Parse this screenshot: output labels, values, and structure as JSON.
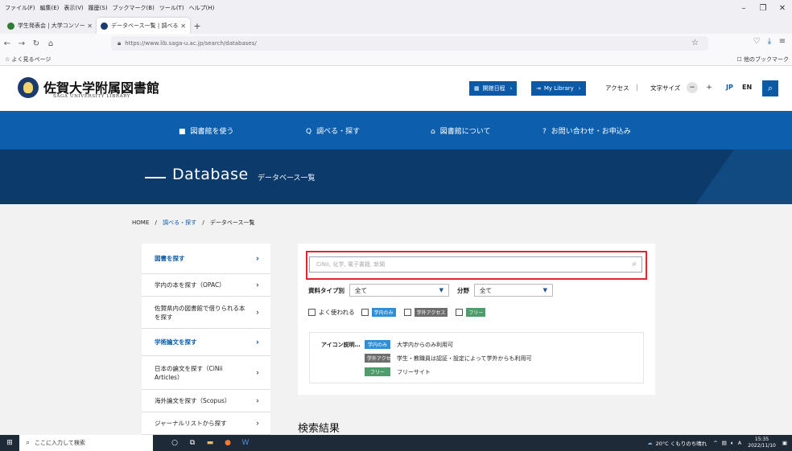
{
  "menubar": [
    "ファイル(F)",
    "編集(E)",
    "表示(V)",
    "履歴(S)",
    "ブックマーク(B)",
    "ツール(T)",
    "ヘルプ(H)"
  ],
  "window_controls": [
    "–",
    "❐",
    "✕"
  ],
  "tabs": [
    {
      "title": "学生発表会 | 大学コンソーシアム佐賀",
      "favicon_color": "#2e7d32",
      "active": false
    },
    {
      "title": "データベース一覧 | 調べる・探す | 佐",
      "favicon_color": "#1b3b6f",
      "active": true
    }
  ],
  "newtab_label": "+",
  "url": "https://www.lib.saga-u.ac.jp/search/databases/",
  "bookmarks": {
    "left": "☆ よく見るページ",
    "right": "☐ 他のブックマーク"
  },
  "header": {
    "logo_jp": "佐賀大学附属図書館",
    "logo_en": "SAGA UNIVERSITY LIBRARY",
    "calendar_btn": "開館日程",
    "mylibrary_btn": "My Library",
    "access": "アクセス",
    "separator": "|",
    "font_size": "文字サイズ",
    "minus": "−",
    "plus": "+",
    "jp": "JP",
    "en": "EN"
  },
  "mainnav": [
    {
      "label": "図書館を使う",
      "icon": "■"
    },
    {
      "label": "調べる・探す",
      "icon": "Q"
    },
    {
      "label": "図書館について",
      "icon": "⌂"
    },
    {
      "label": "お問い合わせ・お申込み",
      "icon": "?"
    }
  ],
  "hero": {
    "title_en": "Database",
    "title_jp": "データベース一覧"
  },
  "breadcrumb": {
    "home": "HOME",
    "sep": "/",
    "level1": "調べる・探す",
    "current": "データベース一覧"
  },
  "sidebar": [
    {
      "label": "図書を探す",
      "type": "cat",
      "h": 38
    },
    {
      "label": "学内の本を探す（OPAC）",
      "type": "sub",
      "h": 28
    },
    {
      "label": "佐賀県内の図書館で借りられる本を探す",
      "type": "sub",
      "h": 40
    },
    {
      "label": "学術論文を探す",
      "type": "cat",
      "h": 34
    },
    {
      "label": "日本の論文を探す（CiNii Articles）",
      "type": "sub",
      "h": 42
    },
    {
      "label": "海外論文を探す（Scopus）",
      "type": "sub",
      "h": 28
    },
    {
      "label": "ジャーナルリストから探す",
      "type": "sub",
      "h": 28
    }
  ],
  "search": {
    "placeholder": "CiNii, 化学, 電子書籍, 新聞"
  },
  "filters": {
    "type_label": "資料タイプ別",
    "type_value": "全て",
    "field_label": "分野",
    "field_value": "全て"
  },
  "checks": {
    "frequent": "よく使われる",
    "campus_tag": "学内のみ",
    "offcampus_tag": "学外アクセス",
    "free_tag": "フリー"
  },
  "legend": {
    "label": "アイコン説明…",
    "rows": [
      {
        "tag": "学内のみ",
        "kind": "in",
        "text": "大学内からのみ利用可"
      },
      {
        "tag": "学外アクセス",
        "kind": "out",
        "text": "学生・教職員は認証・設定によって学外からも利用可"
      },
      {
        "tag": "フリー",
        "kind": "free",
        "text": "フリーサイト"
      }
    ]
  },
  "results_title": "検索結果",
  "taskbar": {
    "search_placeholder": "ここに入力して検索",
    "weather": "20°C くもりのち晴れ",
    "time": "15:35",
    "date": "2022/11/10",
    "ime": "A"
  },
  "colors": {
    "brand_blue": "#0d5fae",
    "hero": "#0b3a6b",
    "highlight_red": "#e2262c"
  }
}
